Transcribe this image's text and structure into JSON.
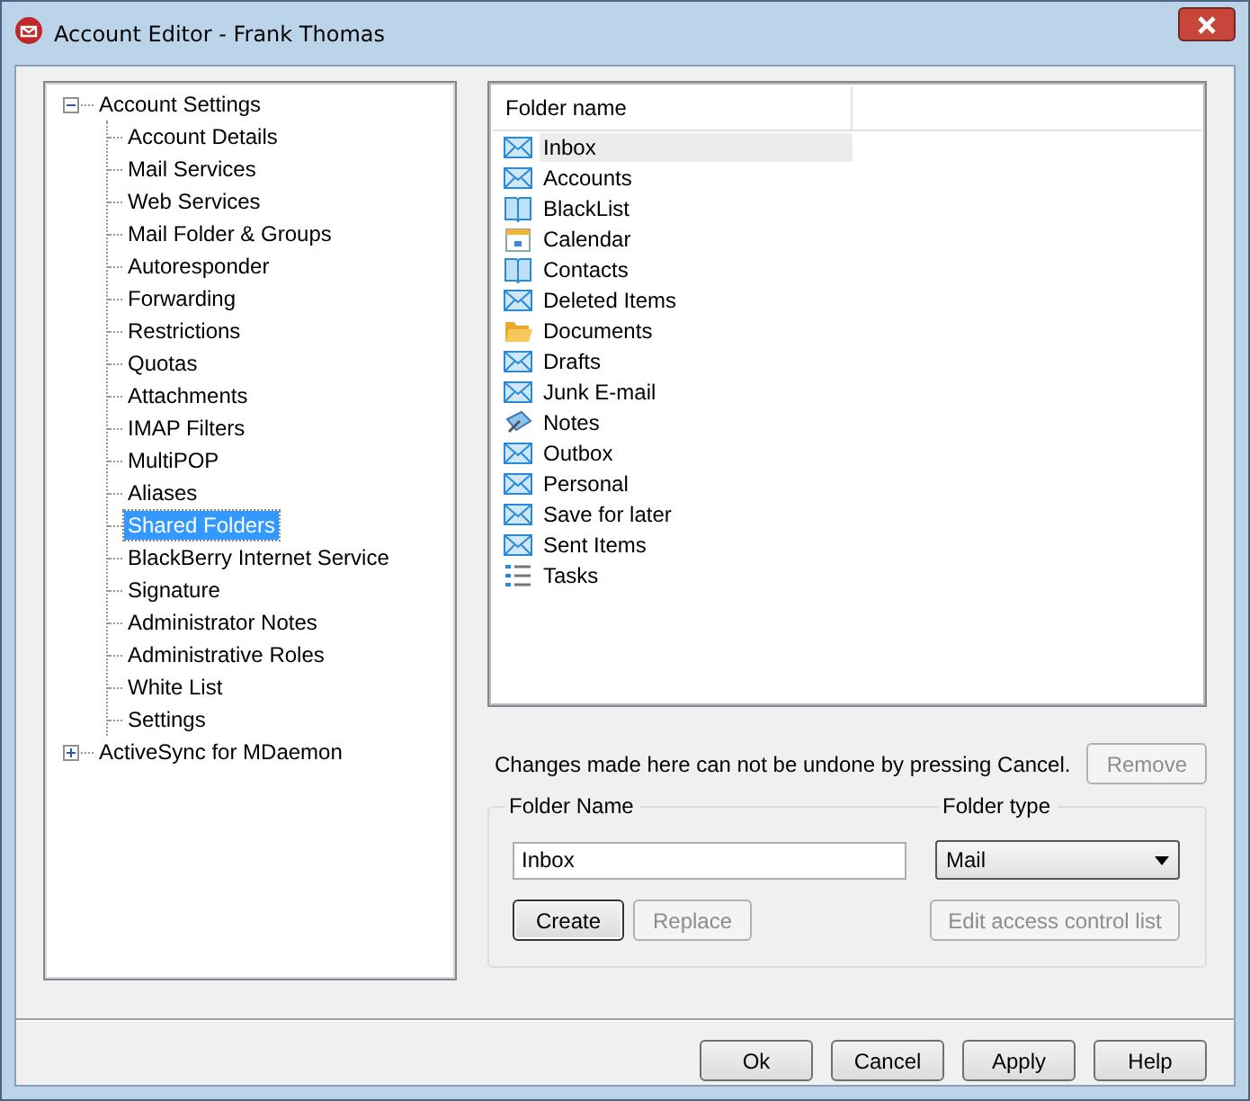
{
  "window": {
    "title": "Account Editor - Frank Thomas"
  },
  "tree": [
    {
      "label": "Account Settings",
      "expanded": true,
      "selected": false,
      "children": [
        {
          "label": "Account Details",
          "selected": false
        },
        {
          "label": "Mail Services",
          "selected": false
        },
        {
          "label": "Web Services",
          "selected": false
        },
        {
          "label": "Mail Folder & Groups",
          "selected": false
        },
        {
          "label": "Autoresponder",
          "selected": false
        },
        {
          "label": "Forwarding",
          "selected": false
        },
        {
          "label": "Restrictions",
          "selected": false
        },
        {
          "label": "Quotas",
          "selected": false
        },
        {
          "label": "Attachments",
          "selected": false
        },
        {
          "label": "IMAP Filters",
          "selected": false
        },
        {
          "label": "MultiPOP",
          "selected": false
        },
        {
          "label": "Aliases",
          "selected": false
        },
        {
          "label": "Shared Folders",
          "selected": true
        },
        {
          "label": "BlackBerry Internet Service",
          "selected": false
        },
        {
          "label": "Signature",
          "selected": false
        },
        {
          "label": "Administrator Notes",
          "selected": false
        },
        {
          "label": "Administrative Roles",
          "selected": false
        },
        {
          "label": "White List",
          "selected": false
        },
        {
          "label": "Settings",
          "selected": false
        }
      ]
    },
    {
      "label": "ActiveSync for MDaemon",
      "expanded": false,
      "selected": false
    }
  ],
  "folders": {
    "columns": [
      "Folder name"
    ],
    "rows": [
      {
        "name": "Inbox",
        "kind": "mail",
        "selected": true
      },
      {
        "name": "Accounts",
        "kind": "mail",
        "selected": false
      },
      {
        "name": "BlackList",
        "kind": "book",
        "selected": false
      },
      {
        "name": "Calendar",
        "kind": "calendar",
        "selected": false
      },
      {
        "name": "Contacts",
        "kind": "book",
        "selected": false
      },
      {
        "name": "Deleted Items",
        "kind": "mail",
        "selected": false
      },
      {
        "name": "Documents",
        "kind": "folder",
        "selected": false
      },
      {
        "name": "Drafts",
        "kind": "mail",
        "selected": false
      },
      {
        "name": "Junk E-mail",
        "kind": "mail",
        "selected": false
      },
      {
        "name": "Notes",
        "kind": "notes",
        "selected": false
      },
      {
        "name": "Outbox",
        "kind": "mail",
        "selected": false
      },
      {
        "name": "Personal",
        "kind": "mail",
        "selected": false
      },
      {
        "name": "Save for later",
        "kind": "mail",
        "selected": false
      },
      {
        "name": "Sent Items",
        "kind": "mail",
        "selected": false
      },
      {
        "name": "Tasks",
        "kind": "tasks",
        "selected": false
      }
    ]
  },
  "notice": "Changes made here can not be undone by pressing Cancel.",
  "remove_button": {
    "label": "Remove",
    "disabled": true
  },
  "folder_group": {
    "name_label": "Folder Name",
    "name_value": "Inbox",
    "type_label": "Folder type",
    "type_value": "Mail",
    "buttons": [
      {
        "label": "Create",
        "disabled": false
      },
      {
        "label": "Replace",
        "disabled": true
      }
    ],
    "acl_button": {
      "label": "Edit access control list",
      "disabled": true
    }
  },
  "dialog_buttons": [
    {
      "label": "Ok",
      "disabled": false
    },
    {
      "label": "Cancel",
      "disabled": false
    },
    {
      "label": "Apply",
      "disabled": false
    },
    {
      "label": "Help",
      "disabled": false
    }
  ]
}
